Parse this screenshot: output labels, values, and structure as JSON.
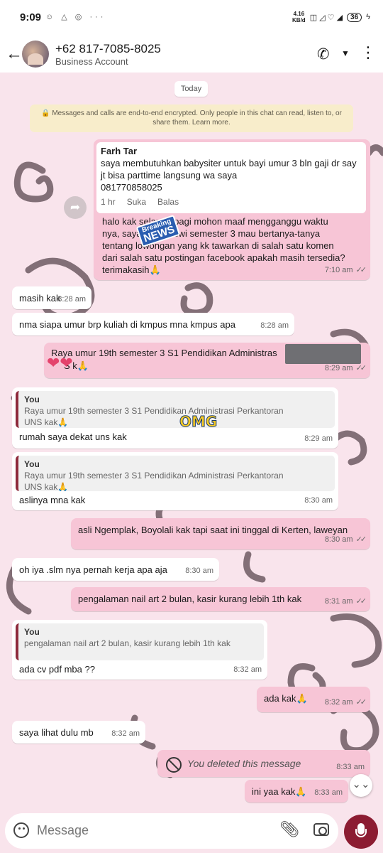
{
  "status_bar": {
    "time": "9:09",
    "net_speed": "4.16",
    "net_unit": "KB/d",
    "battery": "36"
  },
  "header": {
    "contact": "+62 817-7085-8025",
    "subtitle": "Business Account"
  },
  "chat": {
    "date_chip": "Today",
    "encryption_notice": "🔒 Messages and calls are end-to-end encrypted. Only people in this chat can read, listen to, or share them. Learn more.",
    "fb_post": {
      "author": "Farh Tar",
      "line1": "saya membutuhkan babysiter untuk bayi umur 3 bln gaji dr say",
      "line2": "jt bisa parttime langsung wa saya",
      "line3": "081770858025",
      "age": "1 hr",
      "like": "Suka",
      "reply": "Balas"
    },
    "messages": [
      {
        "lines": [
          "halo kak selamat pagi mohon maaf mengganggu waktu",
          "nya, saya mahasiswi semester 3 mau bertanya-tanya",
          "tentang lowongan yang kk tawarkan di salah satu komen",
          "dari salah satu postingan facebook apakah masih tersedia?",
          "terimakasih🙏"
        ],
        "time": "7:10 am"
      },
      {
        "text": "masih kak",
        "time": "8:28 am"
      },
      {
        "text": "nma siapa umur brp kuliah di kmpus mna kmpus apa",
        "time": "8:28 am"
      },
      {
        "line1": "Raya umur 19th semester 3 S1 Pendidikan Administras",
        "line2": "S  k🙏",
        "time": "8:29 am"
      },
      {
        "quote_who": "You",
        "quote1": "Raya umur 19th semester 3 S1 Pendidikan Administrasi Perkantoran",
        "quote2": "UNS kak🙏",
        "text": "rumah saya dekat uns kak",
        "time": "8:29 am"
      },
      {
        "quote_who": "You",
        "quote1": "Raya umur 19th semester 3 S1 Pendidikan Administrasi Perkantoran",
        "quote2": "UNS kak🙏",
        "text": "aslinya mna kak",
        "time": "8:30 am"
      },
      {
        "text": "asli Ngemplak, Boyolali kak tapi saat ini tinggal di Kerten, laweyan",
        "time": "8:30 am"
      },
      {
        "text": "oh iya .slm nya pernah kerja apa aja",
        "time": "8:30 am"
      },
      {
        "text": "pengalaman nail art 2 bulan, kasir kurang lebih 1th kak",
        "time": "8:31 am"
      },
      {
        "quote_who": "You",
        "quote1": "pengalaman nail art 2 bulan, kasir kurang lebih 1th kak",
        "text": "ada cv pdf mba ??",
        "time": "8:32 am"
      },
      {
        "text": "ada kak🙏",
        "time": "8:32 am"
      },
      {
        "text": "saya lihat dulu mb",
        "time": "8:32 am"
      },
      {
        "text": "You deleted this message",
        "time": "8:33 am"
      },
      {
        "text": "ini yaa kak🙏",
        "time": "8:33 am"
      }
    ],
    "stickers": {
      "breaking": "Breaking",
      "news": "NEWS",
      "omg": "OMG"
    }
  },
  "composer": {
    "placeholder": "Message"
  },
  "colors": {
    "outgoing": "#f7c5d6",
    "incoming": "#ffffff",
    "mic": "#8c1c32",
    "quote_bar": "#8e2a3c"
  },
  "icons": [
    "back-arrow-icon",
    "call-icon",
    "more-vert-icon",
    "forward-icon",
    "emoji-icon",
    "attach-icon",
    "camera-icon",
    "mic-icon",
    "scroll-down-icon"
  ]
}
